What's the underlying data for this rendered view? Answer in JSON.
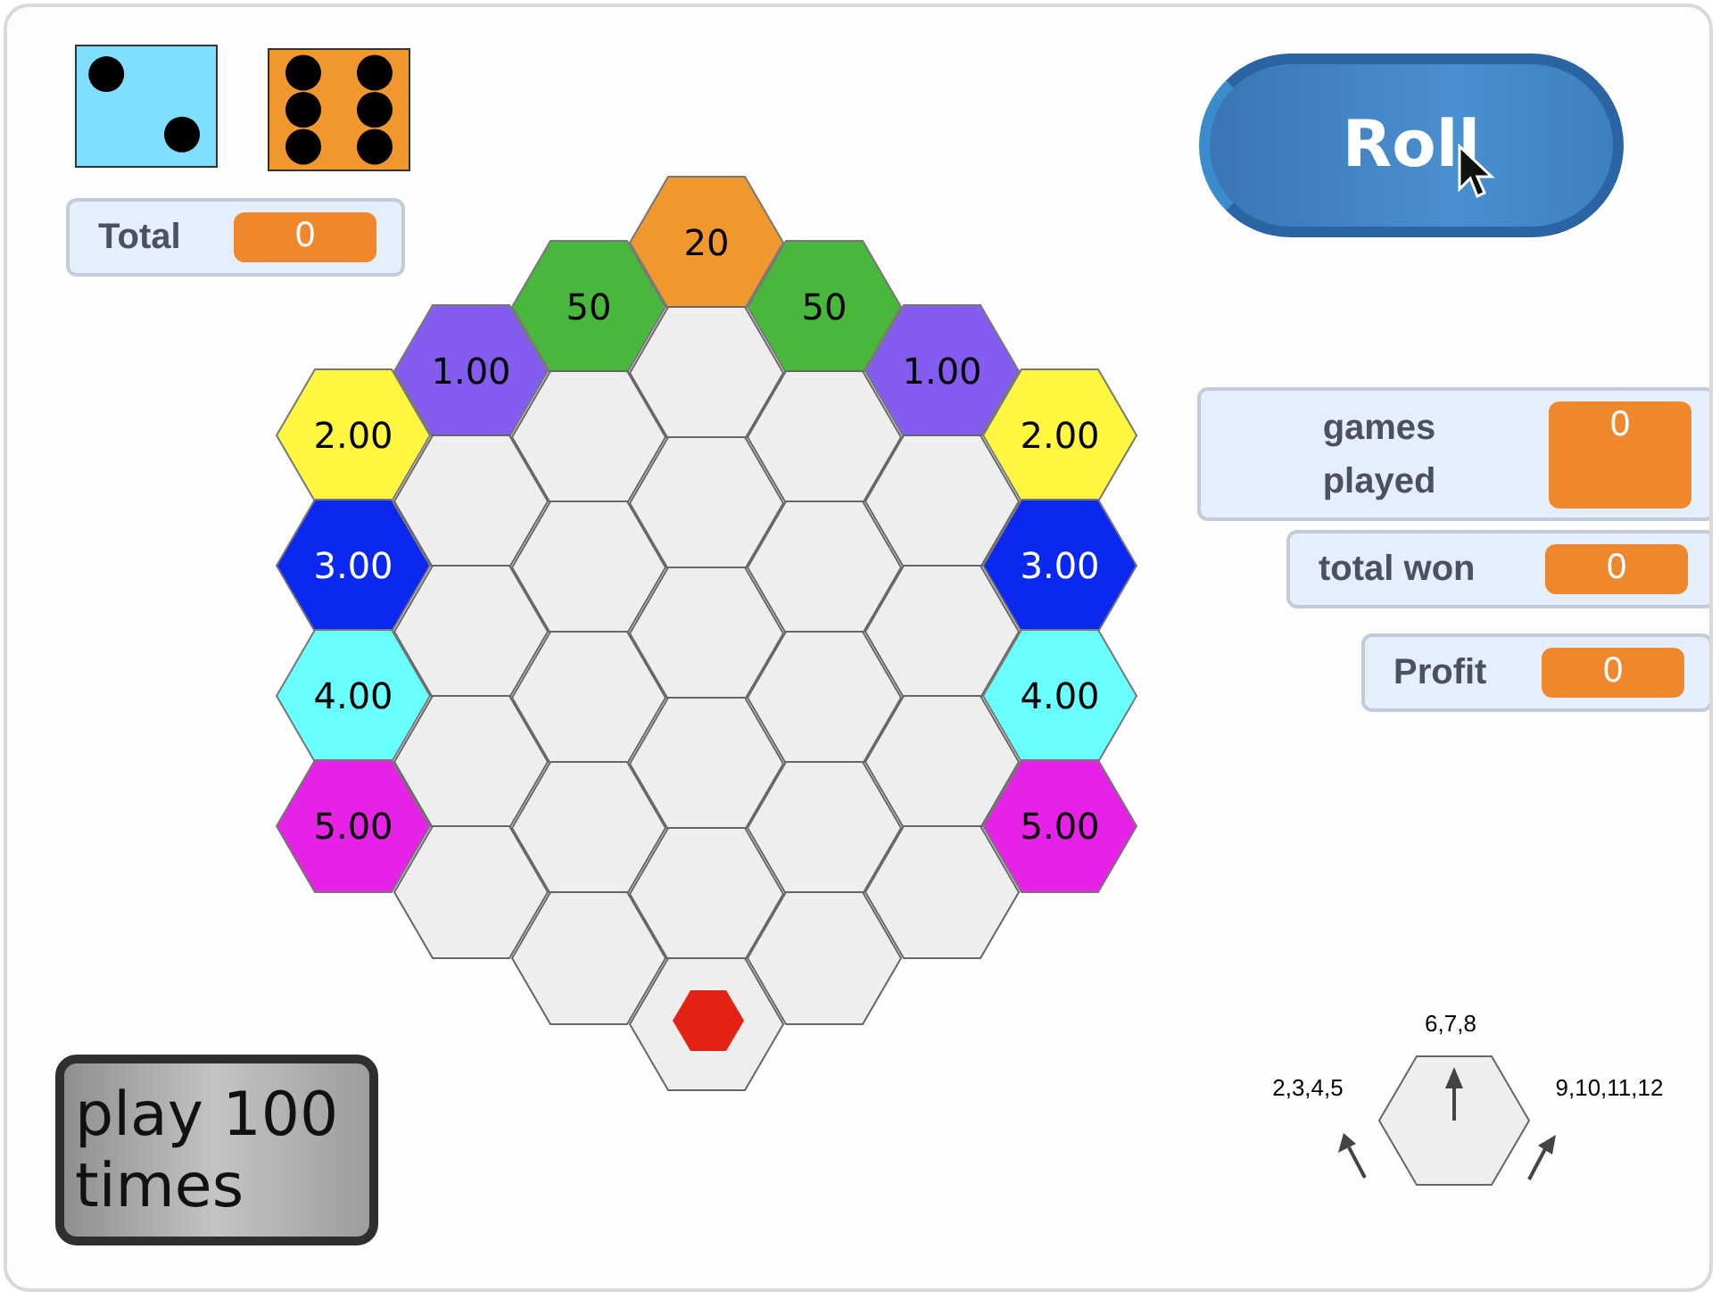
{
  "dice": [
    {
      "kind": "two",
      "color": "#80dfff"
    },
    {
      "kind": "six",
      "color": "#f0982e"
    }
  ],
  "monitors": [
    {
      "label": "Total",
      "value": "0"
    },
    {
      "label": "games played",
      "value": "0"
    },
    {
      "label": "total won",
      "value": "0"
    },
    {
      "label": "Profit",
      "value": "0"
    }
  ],
  "roll_button": {
    "label": "Roll"
  },
  "play_button": {
    "label": "play 100 times"
  },
  "board": {
    "columns": [
      [
        {
          "kind": "prize",
          "label": "2.00",
          "color": "#fff640"
        },
        {
          "kind": "prize",
          "label": "3.00",
          "color": "#0a28f0"
        },
        {
          "kind": "prize",
          "label": "4.00",
          "color": "#6affff"
        },
        {
          "kind": "prize",
          "label": "5.00",
          "color": "#e622e6"
        }
      ],
      [
        {
          "kind": "prize",
          "label": "1.00",
          "color": "#855cf0"
        },
        {
          "kind": "blank"
        },
        {
          "kind": "blank"
        },
        {
          "kind": "blank"
        },
        {
          "kind": "blank"
        }
      ],
      [
        {
          "kind": "prize",
          "label": "50",
          "color": "#48b73c"
        },
        {
          "kind": "blank"
        },
        {
          "kind": "blank"
        },
        {
          "kind": "blank"
        },
        {
          "kind": "blank"
        },
        {
          "kind": "blank"
        }
      ],
      [
        {
          "kind": "prize",
          "label": "20",
          "color": "#f0982e"
        },
        {
          "kind": "blank"
        },
        {
          "kind": "blank"
        },
        {
          "kind": "blank"
        },
        {
          "kind": "blank"
        },
        {
          "kind": "blank"
        },
        {
          "kind": "start"
        }
      ],
      [
        {
          "kind": "prize",
          "label": "50",
          "color": "#48b73c"
        },
        {
          "kind": "blank"
        },
        {
          "kind": "blank"
        },
        {
          "kind": "blank"
        },
        {
          "kind": "blank"
        },
        {
          "kind": "blank"
        }
      ],
      [
        {
          "kind": "prize",
          "label": "1.00",
          "color": "#855cf0"
        },
        {
          "kind": "blank"
        },
        {
          "kind": "blank"
        },
        {
          "kind": "blank"
        },
        {
          "kind": "blank"
        }
      ],
      [
        {
          "kind": "prize",
          "label": "2.00",
          "color": "#fff640"
        },
        {
          "kind": "prize",
          "label": "3.00",
          "color": "#0a28f0"
        },
        {
          "kind": "prize",
          "label": "4.00",
          "color": "#6affff"
        },
        {
          "kind": "prize",
          "label": "5.00",
          "color": "#e622e6"
        }
      ]
    ]
  },
  "legend": {
    "up_label": "6,7,8",
    "left_label": "2,3,4,5",
    "right_label": "9,10,11,12"
  }
}
